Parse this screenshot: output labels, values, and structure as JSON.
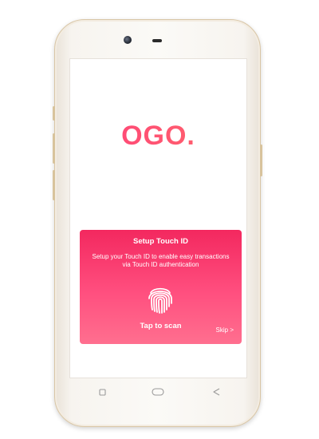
{
  "app": {
    "logo_text": "OGO."
  },
  "touch_id": {
    "title": "Setup Touch ID",
    "description": "Setup your Touch ID to enable easy transactions via Touch ID authentication",
    "scan_label": "Tap to scan",
    "skip_label": "Skip >"
  },
  "icons": {
    "fingerprint": "fingerprint-icon",
    "recent": "recent-apps-icon",
    "home": "home-icon",
    "back": "back-icon"
  },
  "colors": {
    "accent": "#f3285f",
    "accent_light": "#ff6f8f",
    "phone_trim": "#d9c6a6"
  }
}
